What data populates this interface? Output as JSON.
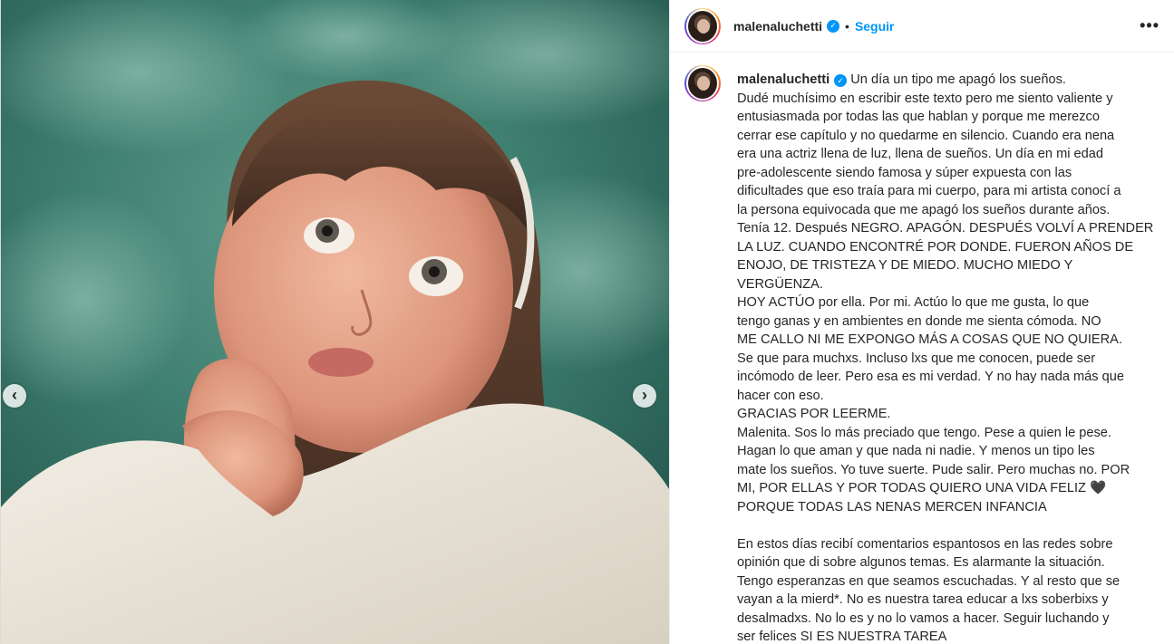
{
  "post": {
    "username": "malenaluchetti",
    "verified_icon": "verified-badge-icon",
    "separator": "•",
    "follow_label": "Seguir",
    "more_label": "•••"
  },
  "media": {
    "prev_label": "‹",
    "next_label": "›"
  },
  "caption": {
    "username": "malenaluchetti",
    "first_line": "Un día un tipo me apagó los sueños.",
    "lines": [
      "Dudé muchísimo en escribir este texto pero me siento valiente y",
      "entusiasmada por todas las que hablan y porque me merezco",
      "cerrar ese capítulo y no quedarme en silencio. Cuando era nena",
      "era una actriz llena de luz, llena de sueños. Un día en mi edad",
      "pre-adolescente siendo famosa y súper expuesta con las",
      "dificultades que eso traía para mi cuerpo, para mi artista conocí a",
      "la persona equivocada que me apagó los sueños durante años.",
      "Tenía 12. Después NEGRO. APAGÓN. DESPUÉS VOLVÍ A PRENDER",
      "LA LUZ. CUANDO ENCONTRÉ POR DONDE. FUERON AÑOS DE",
      "ENOJO, DE TRISTEZA Y DE MIEDO. MUCHO MIEDO Y",
      "VERGÜENZA.",
      "HOY ACTÚO por ella. Por mi. Actúo lo que me gusta, lo que",
      "tengo ganas y en ambientes en donde me sienta cómoda. NO",
      "ME CALLO NI ME EXPONGO MÁS A COSAS QUE NO QUIERA.",
      "Se que para muchxs. Incluso lxs que me conocen, puede ser",
      "incómodo de leer. Pero esa es mi verdad. Y no hay nada más que",
      "hacer con eso.",
      "GRACIAS POR LEERME.",
      "Malenita. Sos lo más preciado que tengo. Pese a quien le pese.",
      "Hagan lo que aman y que nada ni nadie. Y menos un tipo les",
      "mate los sueños. Yo tuve suerte. Pude salir. Pero muchas no. POR",
      "MI, POR ELLAS Y POR TODAS QUIERO UNA VIDA FELIZ 🖤",
      "PORQUE TODAS LAS NENAS MERCEN INFANCIA",
      "",
      "En estos días recibí comentarios espantosos en las redes sobre",
      "opinión que di sobre algunos temas. Es alarmante la situación.",
      "Tengo esperanzas en que seamos escuchadas. Y al resto que se",
      "vayan a la mierd*. No es nuestra tarea educar a lxs soberbixs y",
      "desalmadxs. No lo es y no lo vamos a hacer. Seguir luchando y",
      "ser felices SI ES NUESTRA TAREA"
    ]
  }
}
